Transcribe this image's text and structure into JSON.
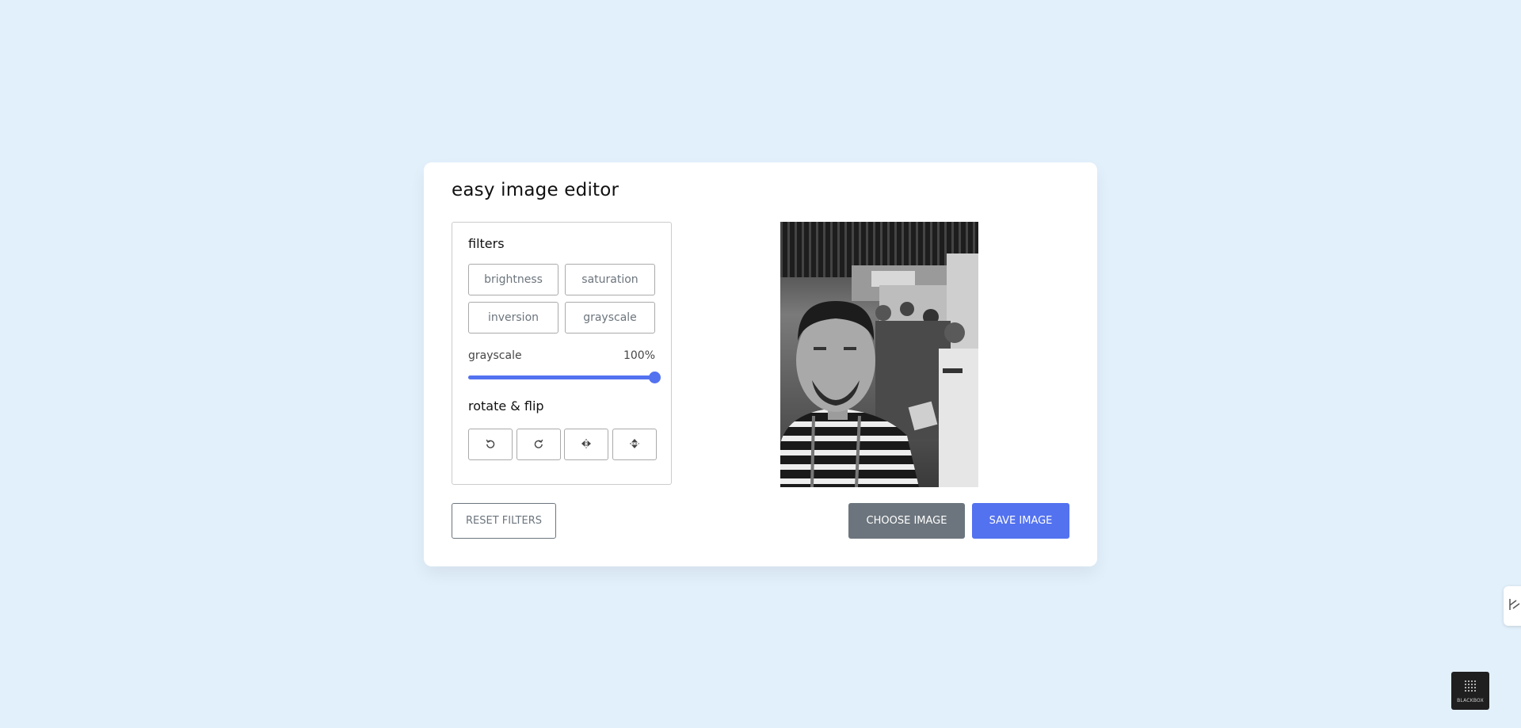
{
  "app": {
    "title": "easy image editor"
  },
  "filters": {
    "heading": "filters",
    "buttons": [
      {
        "label": "brightness"
      },
      {
        "label": "saturation"
      },
      {
        "label": "inversion"
      },
      {
        "label": "grayscale"
      }
    ],
    "active_filter": {
      "name": "grayscale",
      "value_text": "100%",
      "value_fraction": 1.0
    }
  },
  "rotate_flip": {
    "heading": "rotate & flip",
    "buttons": [
      {
        "icon": "rotate-left-icon"
      },
      {
        "icon": "rotate-right-icon"
      },
      {
        "icon": "flip-horizontal-icon"
      },
      {
        "icon": "flip-vertical-icon"
      }
    ]
  },
  "actions": {
    "reset_label": "Reset Filters",
    "choose_label": "Choose Image",
    "save_label": "Save Image"
  },
  "badge": {
    "text": "BLACKBOX"
  },
  "colors": {
    "accent": "#5372f0",
    "secondary": "#6c757d",
    "background": "#e2f0fc"
  }
}
